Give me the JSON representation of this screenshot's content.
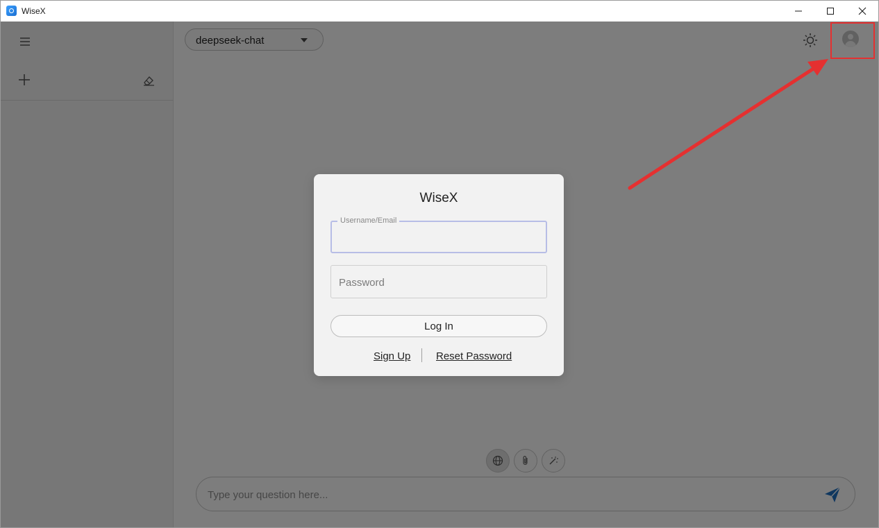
{
  "window": {
    "title": "WiseX",
    "controls": [
      "minimize-icon",
      "maximize-icon",
      "close-icon"
    ]
  },
  "sidebar": {
    "icons": [
      "menu-icon",
      "plus-icon",
      "eraser-icon"
    ]
  },
  "header": {
    "model_select": {
      "value": "deepseek-chat"
    },
    "icons": [
      "sun-icon",
      "user-avatar-icon"
    ]
  },
  "composer": {
    "placeholder": "Type your question here...",
    "tools": [
      "globe-icon",
      "paperclip-icon",
      "magic-wand-icon"
    ],
    "send_icon": "send-icon"
  },
  "login_dialog": {
    "title": "WiseX",
    "username_label": "Username/Email",
    "username_value": "",
    "password_placeholder": "Password",
    "login_button": "Log In",
    "signup_link": "Sign Up",
    "reset_link": "Reset Password"
  },
  "annotation": {
    "color": "#e53030"
  },
  "colors": {
    "overlay": "rgba(0,0,0,0.5)",
    "focus_border": "#b7bde6",
    "send_icon": "#1f6fbf"
  }
}
